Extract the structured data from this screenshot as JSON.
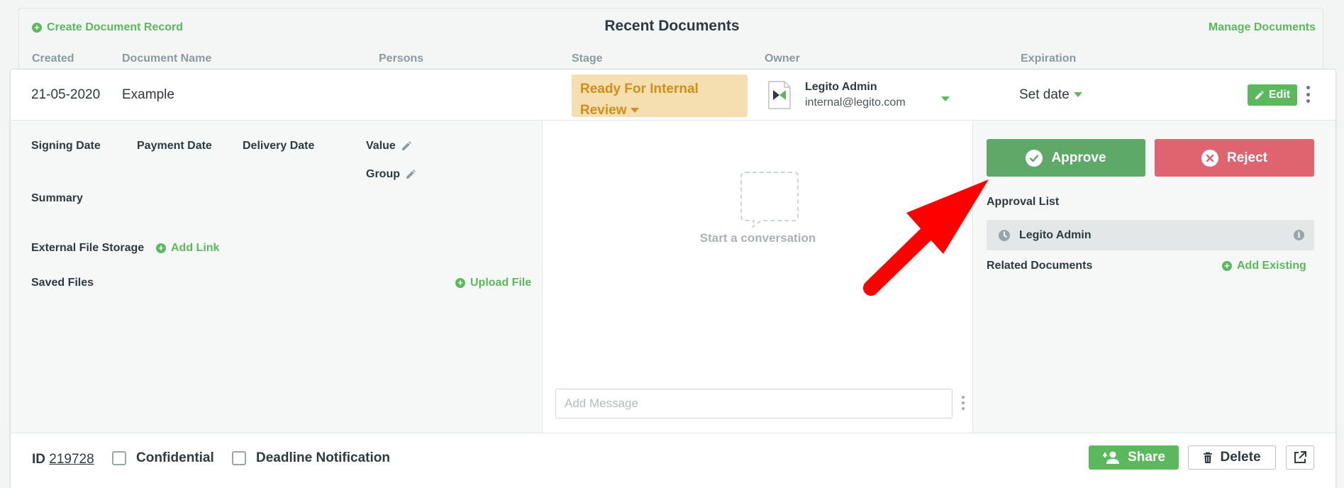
{
  "header": {
    "create_label": "Create Document Record",
    "title": "Recent Documents",
    "manage_label": "Manage Documents"
  },
  "columns": {
    "created": "Created",
    "document_name": "Document Name",
    "persons": "Persons",
    "stage": "Stage",
    "owner": "Owner",
    "expiration": "Expiration"
  },
  "document": {
    "created": "21-05-2020",
    "name": "Example",
    "stage_line1": "Ready For Internal",
    "stage_line2": "Review",
    "owner_name": "Legito Admin",
    "owner_email": "internal@legito.com",
    "expiration": "Set date",
    "edit_label": "Edit"
  },
  "details": {
    "signing_date": "Signing Date",
    "payment_date": "Payment Date",
    "delivery_date": "Delivery Date",
    "value": "Value",
    "group": "Group",
    "summary": "Summary",
    "external_storage": "External File Storage",
    "add_link": "Add Link",
    "saved_files": "Saved Files",
    "upload_file": "Upload File"
  },
  "conversation": {
    "empty_text": "Start a conversation",
    "message_placeholder": "Add Message"
  },
  "approval": {
    "approve_label": "Approve",
    "reject_label": "Reject",
    "list_title": "Approval List",
    "approvers": [
      {
        "name": "Legito Admin"
      }
    ],
    "related_title": "Related Documents",
    "add_existing": "Add Existing"
  },
  "footer": {
    "id_label": "ID",
    "id_value": "219728",
    "confidential": "Confidential",
    "deadline": "Deadline Notification",
    "share_label": "Share",
    "delete_label": "Delete"
  },
  "colors": {
    "accent_green": "#5cb85c",
    "approve": "#5ea968",
    "reject": "#e0646f",
    "stage_bg": "#f5deb0",
    "stage_text": "#d08f1a",
    "annotation_arrow": "#ff0000"
  }
}
